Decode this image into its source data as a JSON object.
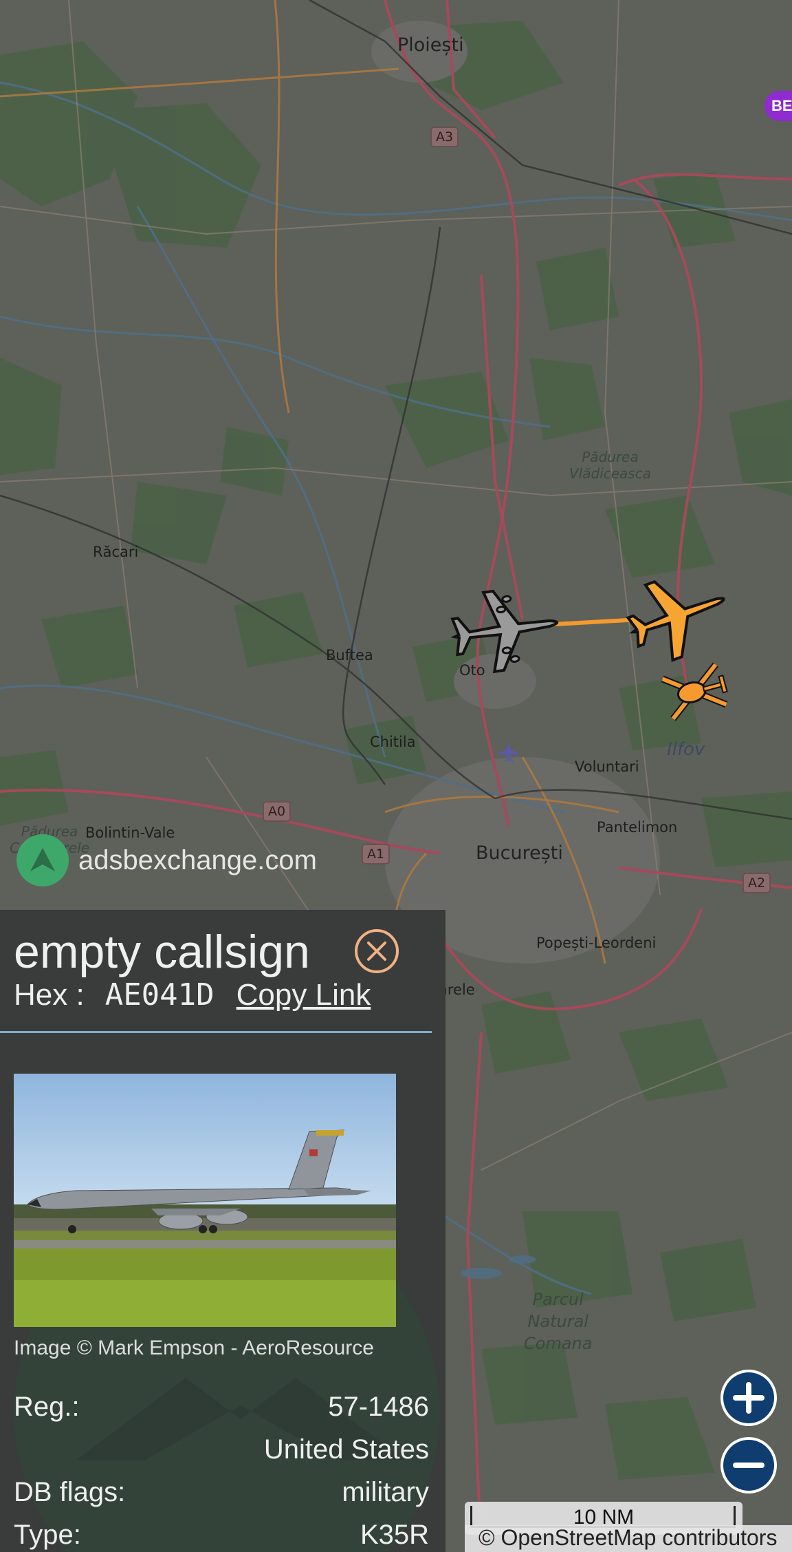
{
  "map": {
    "labels": {
      "ploiesti": "Ploiești",
      "racari": "Răcari",
      "buftea": "Buftea",
      "otopeni": "Oto",
      "chitila": "Chitila",
      "voluntari": "Voluntari",
      "ilfov": "Ilfov",
      "pantelimon": "Pantelimon",
      "bucuresti": "București",
      "bolintin": "Bolintin-Vale",
      "padurea_cas": "Pădurea\nCăscioarele",
      "popesti": "Popești-Leordeni",
      "padurea_vla": "Pădurea\nVlădiceasca",
      "parcul": "Parcul\nNatural\nComana",
      "arele": "arele"
    },
    "shields": {
      "a3": "A3",
      "a0": "A0",
      "a1": "A1",
      "a2": "A2"
    },
    "be_badge": "BE"
  },
  "brand": {
    "text": "adsbexchange.com"
  },
  "panel": {
    "callsign": "empty callsign",
    "hex_label": "Hex :",
    "hex_value": "AE041D",
    "copy_link": "Copy Link",
    "photo_credit": "Image © Mark Empson - AeroResource",
    "rows": {
      "reg_label": "Reg.:",
      "reg_value": "57-1486",
      "country_value": "United States",
      "dbflags_label": "DB flags:",
      "dbflags_value": "military",
      "type_label": "Type:",
      "type_value": "K35R"
    }
  },
  "controls": {
    "scale_text": "10 NM",
    "attribution": "© OpenStreetMap contributors"
  },
  "colors": {
    "accent_orange": "#f7a532",
    "zoom_blue": "#0f3d70",
    "divider": "#7bb2c6",
    "close": "#f0b184"
  }
}
